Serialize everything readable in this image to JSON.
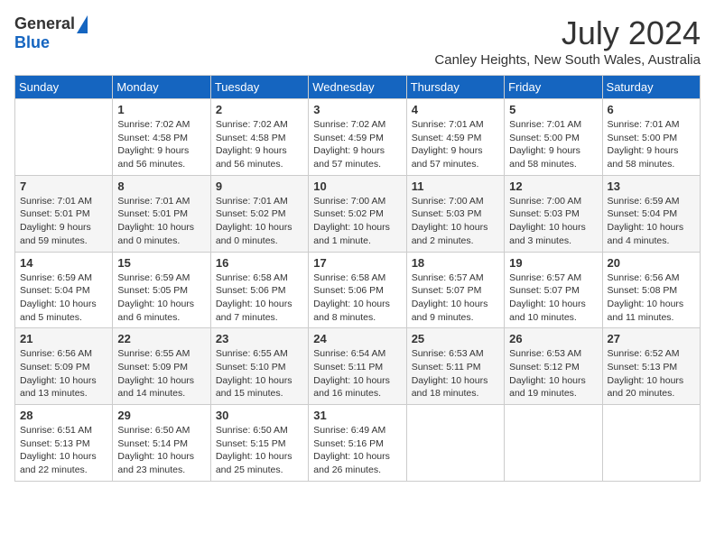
{
  "logo": {
    "general": "General",
    "blue": "Blue"
  },
  "header": {
    "month": "July 2024",
    "location": "Canley Heights, New South Wales, Australia"
  },
  "weekdays": [
    "Sunday",
    "Monday",
    "Tuesday",
    "Wednesday",
    "Thursday",
    "Friday",
    "Saturday"
  ],
  "weeks": [
    [
      {
        "day": "",
        "sunrise": "",
        "sunset": "",
        "daylight": ""
      },
      {
        "day": "1",
        "sunrise": "Sunrise: 7:02 AM",
        "sunset": "Sunset: 4:58 PM",
        "daylight": "Daylight: 9 hours and 56 minutes."
      },
      {
        "day": "2",
        "sunrise": "Sunrise: 7:02 AM",
        "sunset": "Sunset: 4:58 PM",
        "daylight": "Daylight: 9 hours and 56 minutes."
      },
      {
        "day": "3",
        "sunrise": "Sunrise: 7:02 AM",
        "sunset": "Sunset: 4:59 PM",
        "daylight": "Daylight: 9 hours and 57 minutes."
      },
      {
        "day": "4",
        "sunrise": "Sunrise: 7:01 AM",
        "sunset": "Sunset: 4:59 PM",
        "daylight": "Daylight: 9 hours and 57 minutes."
      },
      {
        "day": "5",
        "sunrise": "Sunrise: 7:01 AM",
        "sunset": "Sunset: 5:00 PM",
        "daylight": "Daylight: 9 hours and 58 minutes."
      },
      {
        "day": "6",
        "sunrise": "Sunrise: 7:01 AM",
        "sunset": "Sunset: 5:00 PM",
        "daylight": "Daylight: 9 hours and 58 minutes."
      }
    ],
    [
      {
        "day": "7",
        "sunrise": "Sunrise: 7:01 AM",
        "sunset": "Sunset: 5:01 PM",
        "daylight": "Daylight: 9 hours and 59 minutes."
      },
      {
        "day": "8",
        "sunrise": "Sunrise: 7:01 AM",
        "sunset": "Sunset: 5:01 PM",
        "daylight": "Daylight: 10 hours and 0 minutes."
      },
      {
        "day": "9",
        "sunrise": "Sunrise: 7:01 AM",
        "sunset": "Sunset: 5:02 PM",
        "daylight": "Daylight: 10 hours and 0 minutes."
      },
      {
        "day": "10",
        "sunrise": "Sunrise: 7:00 AM",
        "sunset": "Sunset: 5:02 PM",
        "daylight": "Daylight: 10 hours and 1 minute."
      },
      {
        "day": "11",
        "sunrise": "Sunrise: 7:00 AM",
        "sunset": "Sunset: 5:03 PM",
        "daylight": "Daylight: 10 hours and 2 minutes."
      },
      {
        "day": "12",
        "sunrise": "Sunrise: 7:00 AM",
        "sunset": "Sunset: 5:03 PM",
        "daylight": "Daylight: 10 hours and 3 minutes."
      },
      {
        "day": "13",
        "sunrise": "Sunrise: 6:59 AM",
        "sunset": "Sunset: 5:04 PM",
        "daylight": "Daylight: 10 hours and 4 minutes."
      }
    ],
    [
      {
        "day": "14",
        "sunrise": "Sunrise: 6:59 AM",
        "sunset": "Sunset: 5:04 PM",
        "daylight": "Daylight: 10 hours and 5 minutes."
      },
      {
        "day": "15",
        "sunrise": "Sunrise: 6:59 AM",
        "sunset": "Sunset: 5:05 PM",
        "daylight": "Daylight: 10 hours and 6 minutes."
      },
      {
        "day": "16",
        "sunrise": "Sunrise: 6:58 AM",
        "sunset": "Sunset: 5:06 PM",
        "daylight": "Daylight: 10 hours and 7 minutes."
      },
      {
        "day": "17",
        "sunrise": "Sunrise: 6:58 AM",
        "sunset": "Sunset: 5:06 PM",
        "daylight": "Daylight: 10 hours and 8 minutes."
      },
      {
        "day": "18",
        "sunrise": "Sunrise: 6:57 AM",
        "sunset": "Sunset: 5:07 PM",
        "daylight": "Daylight: 10 hours and 9 minutes."
      },
      {
        "day": "19",
        "sunrise": "Sunrise: 6:57 AM",
        "sunset": "Sunset: 5:07 PM",
        "daylight": "Daylight: 10 hours and 10 minutes."
      },
      {
        "day": "20",
        "sunrise": "Sunrise: 6:56 AM",
        "sunset": "Sunset: 5:08 PM",
        "daylight": "Daylight: 10 hours and 11 minutes."
      }
    ],
    [
      {
        "day": "21",
        "sunrise": "Sunrise: 6:56 AM",
        "sunset": "Sunset: 5:09 PM",
        "daylight": "Daylight: 10 hours and 13 minutes."
      },
      {
        "day": "22",
        "sunrise": "Sunrise: 6:55 AM",
        "sunset": "Sunset: 5:09 PM",
        "daylight": "Daylight: 10 hours and 14 minutes."
      },
      {
        "day": "23",
        "sunrise": "Sunrise: 6:55 AM",
        "sunset": "Sunset: 5:10 PM",
        "daylight": "Daylight: 10 hours and 15 minutes."
      },
      {
        "day": "24",
        "sunrise": "Sunrise: 6:54 AM",
        "sunset": "Sunset: 5:11 PM",
        "daylight": "Daylight: 10 hours and 16 minutes."
      },
      {
        "day": "25",
        "sunrise": "Sunrise: 6:53 AM",
        "sunset": "Sunset: 5:11 PM",
        "daylight": "Daylight: 10 hours and 18 minutes."
      },
      {
        "day": "26",
        "sunrise": "Sunrise: 6:53 AM",
        "sunset": "Sunset: 5:12 PM",
        "daylight": "Daylight: 10 hours and 19 minutes."
      },
      {
        "day": "27",
        "sunrise": "Sunrise: 6:52 AM",
        "sunset": "Sunset: 5:13 PM",
        "daylight": "Daylight: 10 hours and 20 minutes."
      }
    ],
    [
      {
        "day": "28",
        "sunrise": "Sunrise: 6:51 AM",
        "sunset": "Sunset: 5:13 PM",
        "daylight": "Daylight: 10 hours and 22 minutes."
      },
      {
        "day": "29",
        "sunrise": "Sunrise: 6:50 AM",
        "sunset": "Sunset: 5:14 PM",
        "daylight": "Daylight: 10 hours and 23 minutes."
      },
      {
        "day": "30",
        "sunrise": "Sunrise: 6:50 AM",
        "sunset": "Sunset: 5:15 PM",
        "daylight": "Daylight: 10 hours and 25 minutes."
      },
      {
        "day": "31",
        "sunrise": "Sunrise: 6:49 AM",
        "sunset": "Sunset: 5:16 PM",
        "daylight": "Daylight: 10 hours and 26 minutes."
      },
      {
        "day": "",
        "sunrise": "",
        "sunset": "",
        "daylight": ""
      },
      {
        "day": "",
        "sunrise": "",
        "sunset": "",
        "daylight": ""
      },
      {
        "day": "",
        "sunrise": "",
        "sunset": "",
        "daylight": ""
      }
    ]
  ]
}
